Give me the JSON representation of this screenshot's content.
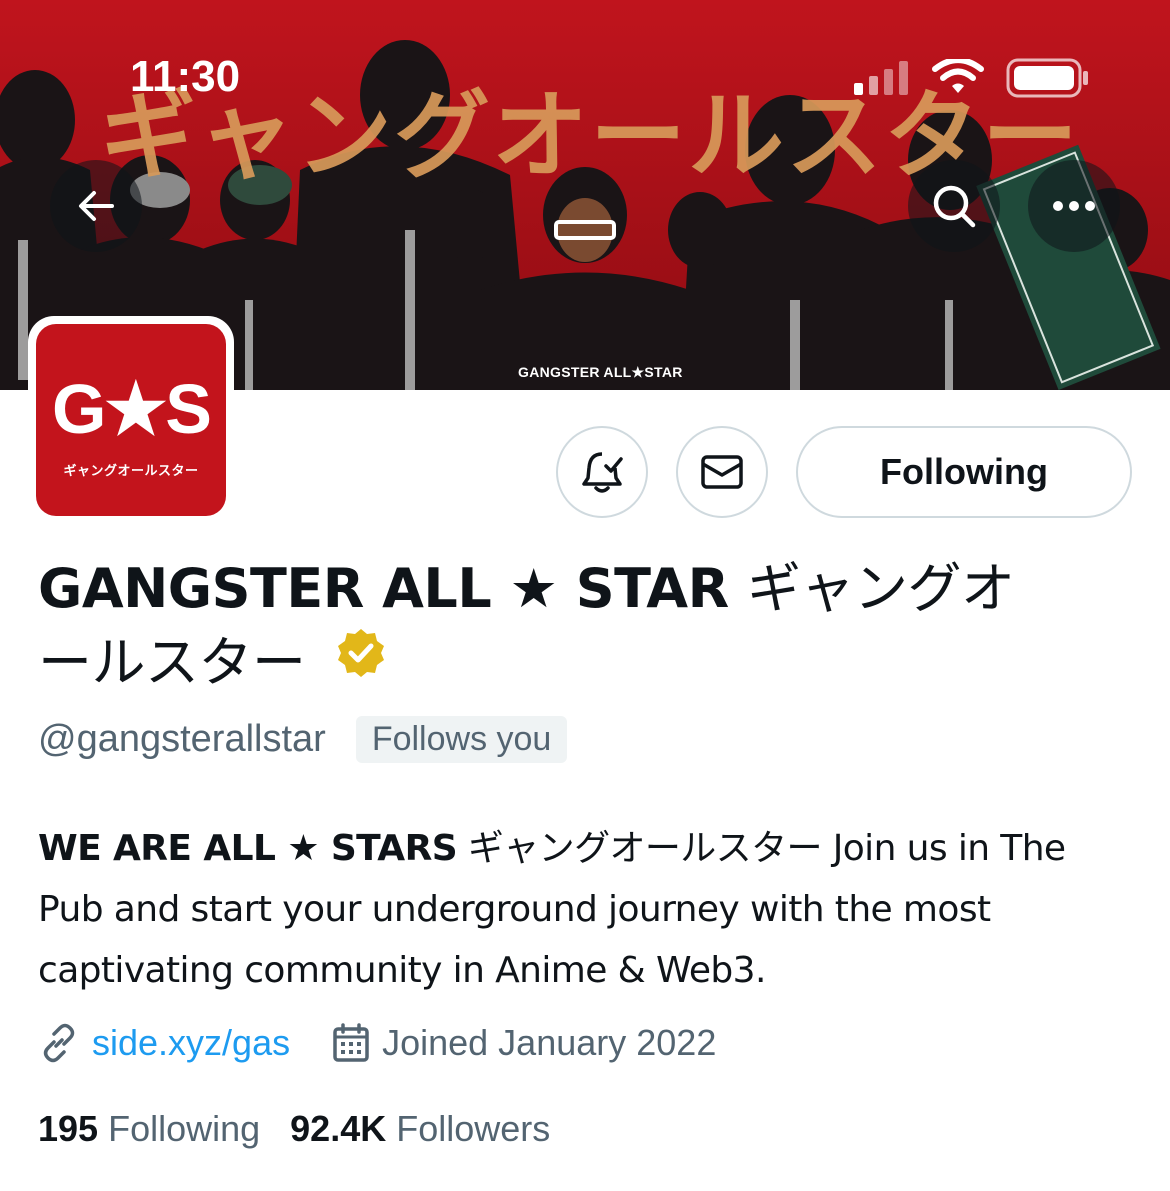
{
  "status_bar": {
    "time": "11:30"
  },
  "banner": {
    "headline_jp": "ギャングオールスター",
    "caption": "GANGSTER ALL★STAR",
    "background_color": "#b3121a"
  },
  "nav": {
    "back_icon": "arrow-left-icon",
    "search_icon": "search-icon",
    "more_icon": "more-horizontal-icon"
  },
  "avatar": {
    "logo_text": "G★S",
    "logo_subtext": "ギャングオールスター",
    "background_color": "#c3141c"
  },
  "actions": {
    "notify_icon": "bell-check-icon",
    "message_icon": "envelope-icon",
    "following_label": "Following"
  },
  "profile": {
    "name_latin": "GANGSTER ALL ★ STAR",
    "name_jp": "ギャングオールスター",
    "verified_color": "#e2b719",
    "handle": "@gangsterallstar",
    "follows_you": "Follows you"
  },
  "bio": {
    "lead": "WE ARE ALL ★ STARS",
    "rest": "ギャングオールスター Join us in The Pub and start your underground journey with the most captivating community in Anime & Web3."
  },
  "meta": {
    "link_text": "side.xyz/gas",
    "link_color": "#1d9bf0",
    "joined_text": "Joined January 2022"
  },
  "stats": {
    "following_count": "195",
    "following_label": "Following",
    "followers_count": "92.4K",
    "followers_label": "Followers"
  }
}
